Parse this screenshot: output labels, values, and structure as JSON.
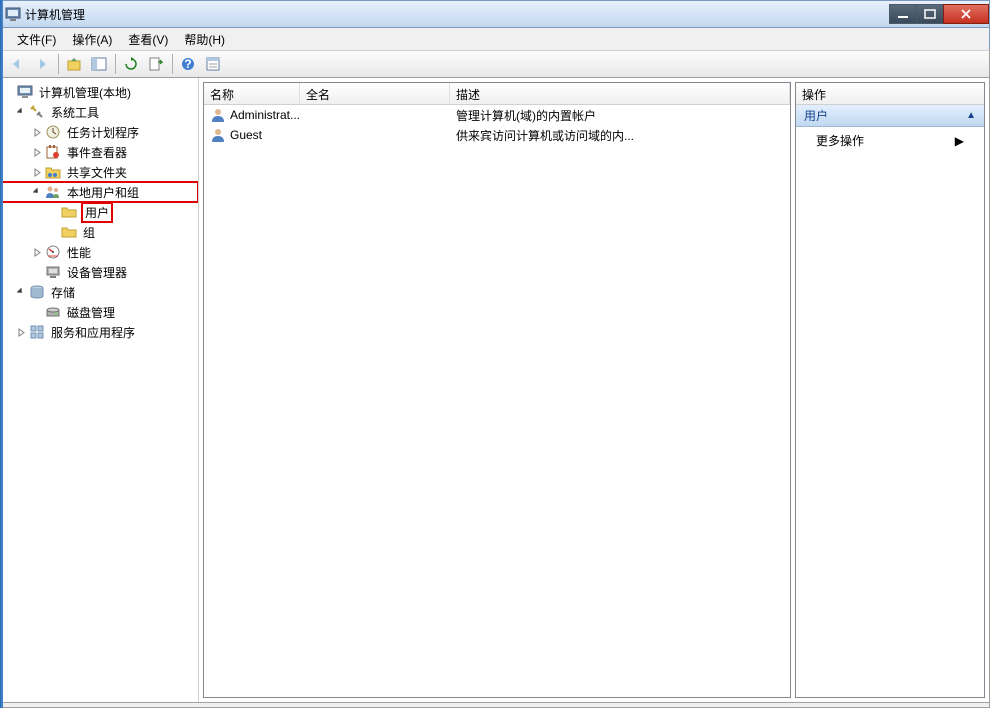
{
  "window": {
    "title": "计算机管理"
  },
  "menu": {
    "file": "文件(F)",
    "action": "操作(A)",
    "view": "查看(V)",
    "help": "帮助(H)"
  },
  "tree": {
    "root": "计算机管理(本地)",
    "sys_tools": "系统工具",
    "task_sched": "任务计划程序",
    "event_viewer": "事件查看器",
    "shared_folders": "共享文件夹",
    "local_users": "本地用户和组",
    "users": "用户",
    "groups": "组",
    "performance": "性能",
    "device_mgr": "设备管理器",
    "storage": "存储",
    "disk_mgmt": "磁盘管理",
    "services_apps": "服务和应用程序"
  },
  "columns": {
    "name": "名称",
    "fullname": "全名",
    "desc": "描述"
  },
  "users": [
    {
      "name": "Administrat...",
      "fullname": "",
      "desc": "管理计算机(域)的内置帐户"
    },
    {
      "name": "Guest",
      "fullname": "",
      "desc": "供来宾访问计算机或访问域的内..."
    }
  ],
  "actions": {
    "header": "操作",
    "section": "用户",
    "more": "更多操作"
  }
}
